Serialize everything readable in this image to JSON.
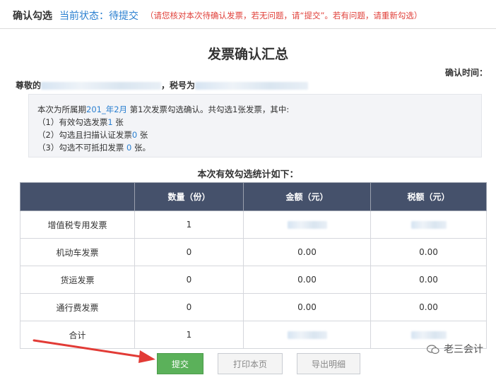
{
  "topbar": {
    "title": "确认勾选",
    "status": "当前状态：待提交",
    "notice": "（请您核对本次待确认发票，若无问题，请“提交”。若有问题，请重新勾选）"
  },
  "page_title": "发票确认汇总",
  "confirm_time_label": "确认时间：",
  "respect_prefix": "尊敬的",
  "tax_no_label": "，税号为",
  "summary": {
    "intro_part1": "本次为所属期",
    "period_year": "201_年",
    "period_month": "2月",
    "intro_part2": " 第1次发票勾选确认。共勾选1张发票，其中:",
    "line1_text": "（1）有效勾选发票",
    "line1_value": "1",
    "line1_unit": " 张",
    "line2_text": "（2）勾选且扫描认证发票",
    "line2_value": "0",
    "line2_unit": " 张",
    "line3_text": "（3）勾选不可抵扣发票 ",
    "line3_value": "0",
    "line3_unit": " 张。"
  },
  "stat_heading": "本次有效勾选统计如下：",
  "table": {
    "headers": [
      "",
      "数量（份）",
      "金额（元）",
      "税额（元）"
    ],
    "rows": [
      {
        "name": "增值税专用发票",
        "count": "1",
        "amount": "",
        "tax": ""
      },
      {
        "name": "机动车发票",
        "count": "0",
        "amount": "0.00",
        "tax": "0.00"
      },
      {
        "name": "货运发票",
        "count": "0",
        "amount": "0.00",
        "tax": "0.00"
      },
      {
        "name": "通行费发票",
        "count": "0",
        "amount": "0.00",
        "tax": "0.00"
      },
      {
        "name": "合计",
        "count": "1",
        "amount": "",
        "tax": ""
      }
    ]
  },
  "buttons": {
    "submit": "提交",
    "print": "打印本页",
    "export": "导出明细"
  },
  "watermark": "老三会计",
  "colors": {
    "header_bg": "#45516b",
    "accent_blue": "#2a7fd0",
    "notice_red": "#e0403a",
    "submit_green": "#5bb15a",
    "arrow_red": "#e23b36"
  }
}
